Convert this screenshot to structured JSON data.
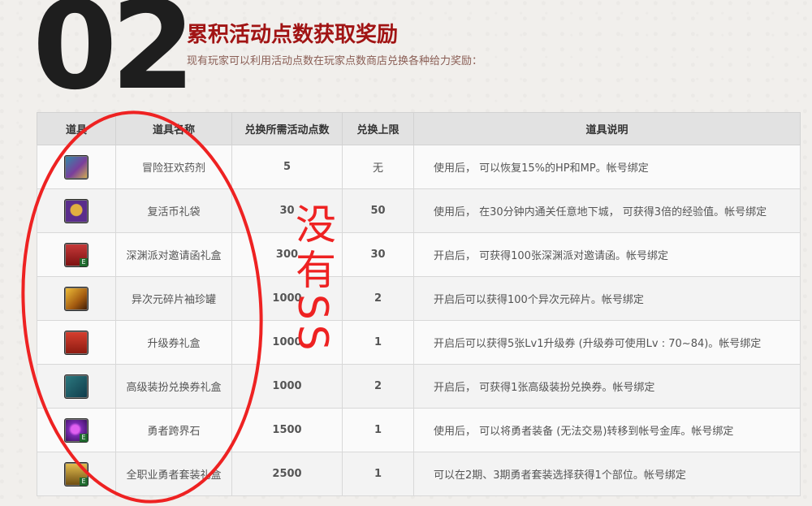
{
  "header": {
    "number": "02",
    "title": "累积活动点数获取奖励",
    "subtitle": "现有玩家可以利用活动点数在玩家点数商店兑换各种给力奖励："
  },
  "table": {
    "columns": [
      "道具",
      "道具名称",
      "兑换所需活动点数",
      "兑换上限",
      "道具说明"
    ],
    "rows": [
      {
        "icon": "potion-icon",
        "name": "冒险狂欢药剂",
        "points": "5",
        "limit": "无",
        "desc": "使用后， 可以恢复15%的HP和MP。帐号绑定"
      },
      {
        "icon": "coin-bag-icon",
        "name": "复活币礼袋",
        "points": "30",
        "limit": "50",
        "desc": "使用后， 在30分钟内通关任意地下城， 可获得3倍的经验值。帐号绑定"
      },
      {
        "icon": "red-gift-box-icon",
        "name": "深渊派对邀请函礼盒",
        "points": "300",
        "limit": "30",
        "desc": "开启后， 可获得100张深渊派对邀请函。帐号绑定"
      },
      {
        "icon": "golden-jar-icon",
        "name": "异次元碎片袖珍罐",
        "points": "1000",
        "limit": "2",
        "desc": "开启后可以获得100个异次元碎片。帐号绑定"
      },
      {
        "icon": "upgrade-gift-icon",
        "name": "升级券礼盒",
        "points": "1000",
        "limit": "1",
        "desc": "开启后可以获得5张Lv1升级券 (升级券可使用Lv : 70~84)。帐号绑定"
      },
      {
        "icon": "ticket-icon",
        "name": "高级装扮兑换券礼盒",
        "points": "1000",
        "limit": "2",
        "desc": "开启后， 可获得1张高级装扮兑换券。帐号绑定"
      },
      {
        "icon": "purple-stone-icon",
        "name": "勇者跨界石",
        "points": "1500",
        "limit": "1",
        "desc": "使用后， 可以将勇者装备 (无法交易)转移到帐号金库。帐号绑定"
      },
      {
        "icon": "gold-chest-icon",
        "name": "全职业勇者套装礼盒",
        "points": "2500",
        "limit": "1",
        "desc": "可以在2期、3期勇者套装选择获得1个部位。帐号绑定"
      }
    ]
  },
  "annotation": {
    "handwritten_text": "没有SS",
    "color": "#ee2222"
  }
}
